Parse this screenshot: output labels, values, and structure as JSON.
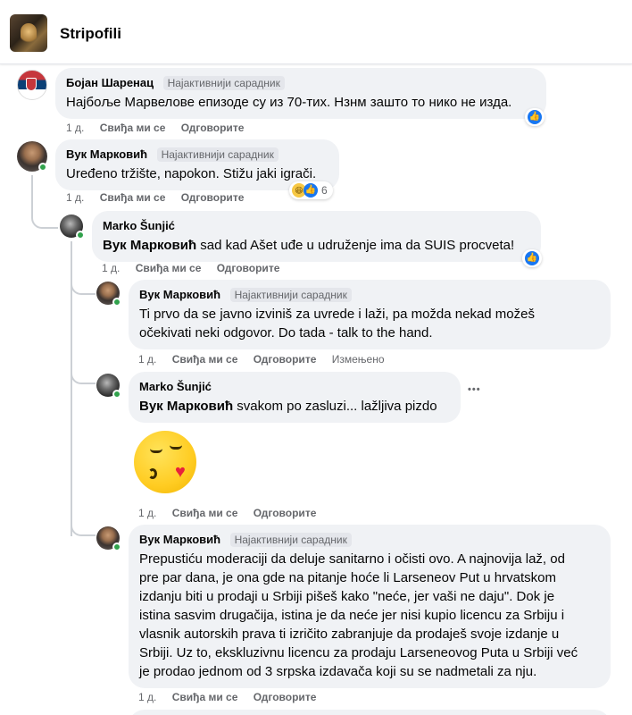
{
  "header": {
    "title": "Stripofili"
  },
  "comments": [
    {
      "author": "Бојан Шаренац",
      "badge": "Најактивнији сарадник",
      "text": "Најбоље Марвелове епизоде су из 70-тих. Нзнм зашто то нико не изда.",
      "time": "1 д.",
      "like": "Свиђа ми се",
      "reply": "Одговорите"
    },
    {
      "author": "Вук Марковић",
      "badge": "Најактивнији сарадник",
      "text": "Uređeno tržište, napokon. Stižu jaki igrači.",
      "time": "1 д.",
      "like": "Свиђа ми се",
      "reply": "Одговорите",
      "reaction_count": "6"
    },
    {
      "author": "Marko Šunjić",
      "mention": "Вук Марковић",
      "text": " sad kad Ašet uđe u udruženje ima da SUIS procveta!",
      "time": "1 д.",
      "like": "Свиђа ми се",
      "reply": "Одговорите"
    },
    {
      "author": "Вук Марковић",
      "badge": "Најактивнији сарадник",
      "text_line1": "Ti prvo da se javno izviniš za uvrede i laži, pa možda nekad možeš",
      "text_line2": "očekivati neki odgovor. Do tada - talk to the hand.",
      "time": "1 д.",
      "like": "Свиђа ми се",
      "reply": "Одговорите",
      "edited": "Измењено"
    },
    {
      "author": "Marko Šunjić",
      "mention": "Вук Марковић",
      "text": " svakom po zasluzi... lažljiva pizdo",
      "more": "•••",
      "time": "1 д.",
      "like": "Свиђа ми се",
      "reply": "Одговорите"
    },
    {
      "author": "Вук Марковић",
      "badge": "Најактивнији сарадник",
      "lines": [
        "Prepustiću moderaciji da deluje sanitarno i očisti ovo. A najnovija laž, od",
        "pre par dana, je ona gde na pitanje hoće li Larseneov Put u hrvatskom",
        "izdanju biti u prodaji u Srbiji pišeš kako \"neće, jer vaši ne daju\". Dok je",
        "istina sasvim drugačija, istina je da neće jer nisi kupio licencu za Srbiju i",
        "vlasnik autorskih prava ti izričito zabranjuje da prodaješ svoje izdanje u",
        "Srbiji. Uz to, ekskluzivnu licencu za prodaju Larseneovog Puta u Srbiji već",
        "je prodao jednom od 3 srpska izdavača koji su se nadmetali za nju."
      ],
      "time": "1 д.",
      "like": "Свиђа ми се",
      "reply": "Одговорите"
    }
  ],
  "colors": {
    "bubble": "#f0f2f5",
    "like_blue": "#1877f2",
    "online_green": "#31a24c",
    "meta_gray": "#65676b"
  },
  "icons": {
    "like": "like-icon",
    "haha": "haha-icon",
    "emoji": "kissing-heart-emoji"
  }
}
